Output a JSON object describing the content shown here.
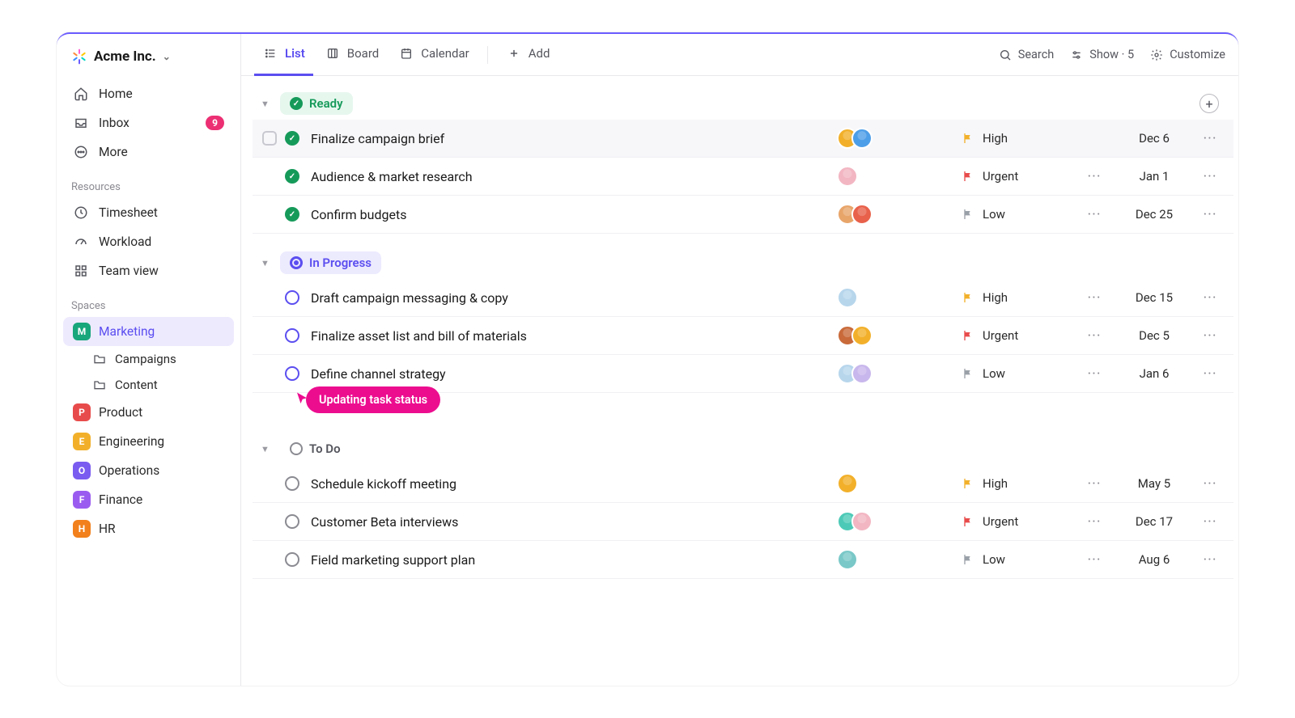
{
  "workspace": {
    "name": "Acme Inc."
  },
  "sidebar": {
    "nav": {
      "home": "Home",
      "inbox": "Inbox",
      "inbox_badge": "9",
      "more": "More"
    },
    "resources_label": "Resources",
    "resources": {
      "timesheet": "Timesheet",
      "workload": "Workload",
      "teamview": "Team view"
    },
    "spaces_label": "Spaces",
    "spaces": [
      {
        "letter": "M",
        "name": "Marketing",
        "color": "#18a67b",
        "active": true
      },
      {
        "letter": "P",
        "name": "Product",
        "color": "#e84b4b"
      },
      {
        "letter": "E",
        "name": "Engineering",
        "color": "#f2b02a"
      },
      {
        "letter": "O",
        "name": "Operations",
        "color": "#7a5cf0"
      },
      {
        "letter": "F",
        "name": "Finance",
        "color": "#9a5cf0"
      },
      {
        "letter": "H",
        "name": "HR",
        "color": "#f2801c"
      }
    ],
    "folders": {
      "campaigns": "Campaigns",
      "content": "Content"
    }
  },
  "toolbar": {
    "views": {
      "list": "List",
      "board": "Board",
      "calendar": "Calendar",
      "add": "Add"
    },
    "search": "Search",
    "show": "Show · 5",
    "customize": "Customize"
  },
  "groups": [
    {
      "id": "ready",
      "label": "Ready",
      "style": "ready",
      "tasks": [
        {
          "name": "Finalize campaign brief",
          "assignees": [
            "#f2b02a",
            "#4d9ee8"
          ],
          "priority": "High",
          "flag": "#f2b02a",
          "date": "Dec 6",
          "highlight": true,
          "checkbox": true,
          "extra": false
        },
        {
          "name": "Audience & market research",
          "assignees": [
            "#f2b6c2"
          ],
          "priority": "Urgent",
          "flag": "#e84b4b",
          "date": "Jan 1",
          "extra": true
        },
        {
          "name": "Confirm budgets",
          "assignees": [
            "#e8a56a",
            "#e8614b"
          ],
          "priority": "Low",
          "flag": "#9aa0a8",
          "date": "Dec 25",
          "extra": true
        }
      ]
    },
    {
      "id": "progress",
      "label": "In Progress",
      "style": "progress",
      "tasks": [
        {
          "name": "Draft campaign messaging & copy",
          "assignees": [
            "#b7d6ec"
          ],
          "priority": "High",
          "flag": "#f2b02a",
          "date": "Dec 15",
          "extra": true
        },
        {
          "name": "Finalize asset list and bill of materials",
          "assignees": [
            "#c96a3a",
            "#f2b02a"
          ],
          "priority": "Urgent",
          "flag": "#e84b4b",
          "date": "Dec 5",
          "extra": true
        },
        {
          "name": "Define channel strategy",
          "assignees": [
            "#b7d6ec",
            "#c8b7ec"
          ],
          "priority": "Low",
          "flag": "#9aa0a8",
          "date": "Jan 6",
          "extra": true
        }
      ]
    },
    {
      "id": "todo",
      "label": "To Do",
      "style": "todo",
      "tasks": [
        {
          "name": "Schedule kickoff meeting",
          "assignees": [
            "#f2b02a"
          ],
          "priority": "High",
          "flag": "#f2b02a",
          "date": "May 5",
          "extra": true
        },
        {
          "name": "Customer Beta interviews",
          "assignees": [
            "#4dcab7",
            "#f2b6c2"
          ],
          "priority": "Urgent",
          "flag": "#e84b4b",
          "date": "Dec 17",
          "extra": true
        },
        {
          "name": "Field marketing support plan",
          "assignees": [
            "#7ac8c8"
          ],
          "priority": "Low",
          "flag": "#9aa0a8",
          "date": "Aug 6",
          "extra": true
        }
      ]
    }
  ],
  "overlay": {
    "label": "Updating task status"
  }
}
